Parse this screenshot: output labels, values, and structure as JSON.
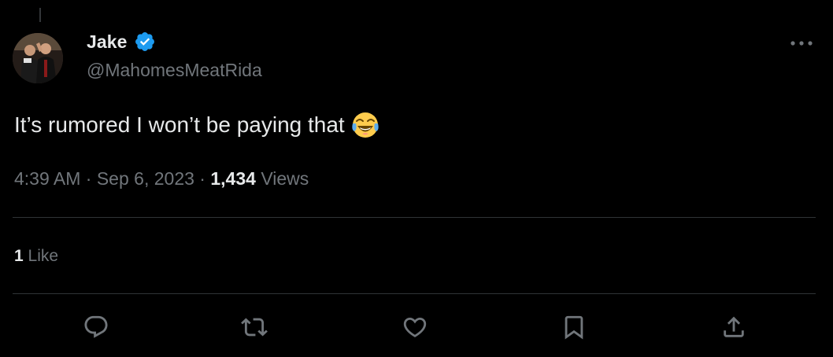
{
  "author": {
    "display_name": "Jake",
    "handle": "@MahomesMeatRida",
    "verified": true,
    "verified_color": "#1d9bf0"
  },
  "tweet": {
    "text": "It’s rumored I won’t be paying that",
    "emoji": "face-with-tears-of-joy"
  },
  "meta": {
    "time": "4:39 AM",
    "separator": "·",
    "date": "Sep 6, 2023",
    "views_count": "1,434",
    "views_label": "Views"
  },
  "stats": {
    "likes_count": "1",
    "likes_label": "Like"
  },
  "actions": [
    {
      "name": "reply",
      "icon": "reply-icon"
    },
    {
      "name": "retweet",
      "icon": "retweet-icon"
    },
    {
      "name": "like",
      "icon": "heart-icon"
    },
    {
      "name": "bookmark",
      "icon": "bookmark-icon"
    },
    {
      "name": "share",
      "icon": "share-icon"
    }
  ],
  "colors": {
    "background": "#000000",
    "primary_text": "#e7e9ea",
    "secondary_text": "#71767b",
    "divider": "#2f3336",
    "accent": "#1d9bf0"
  }
}
